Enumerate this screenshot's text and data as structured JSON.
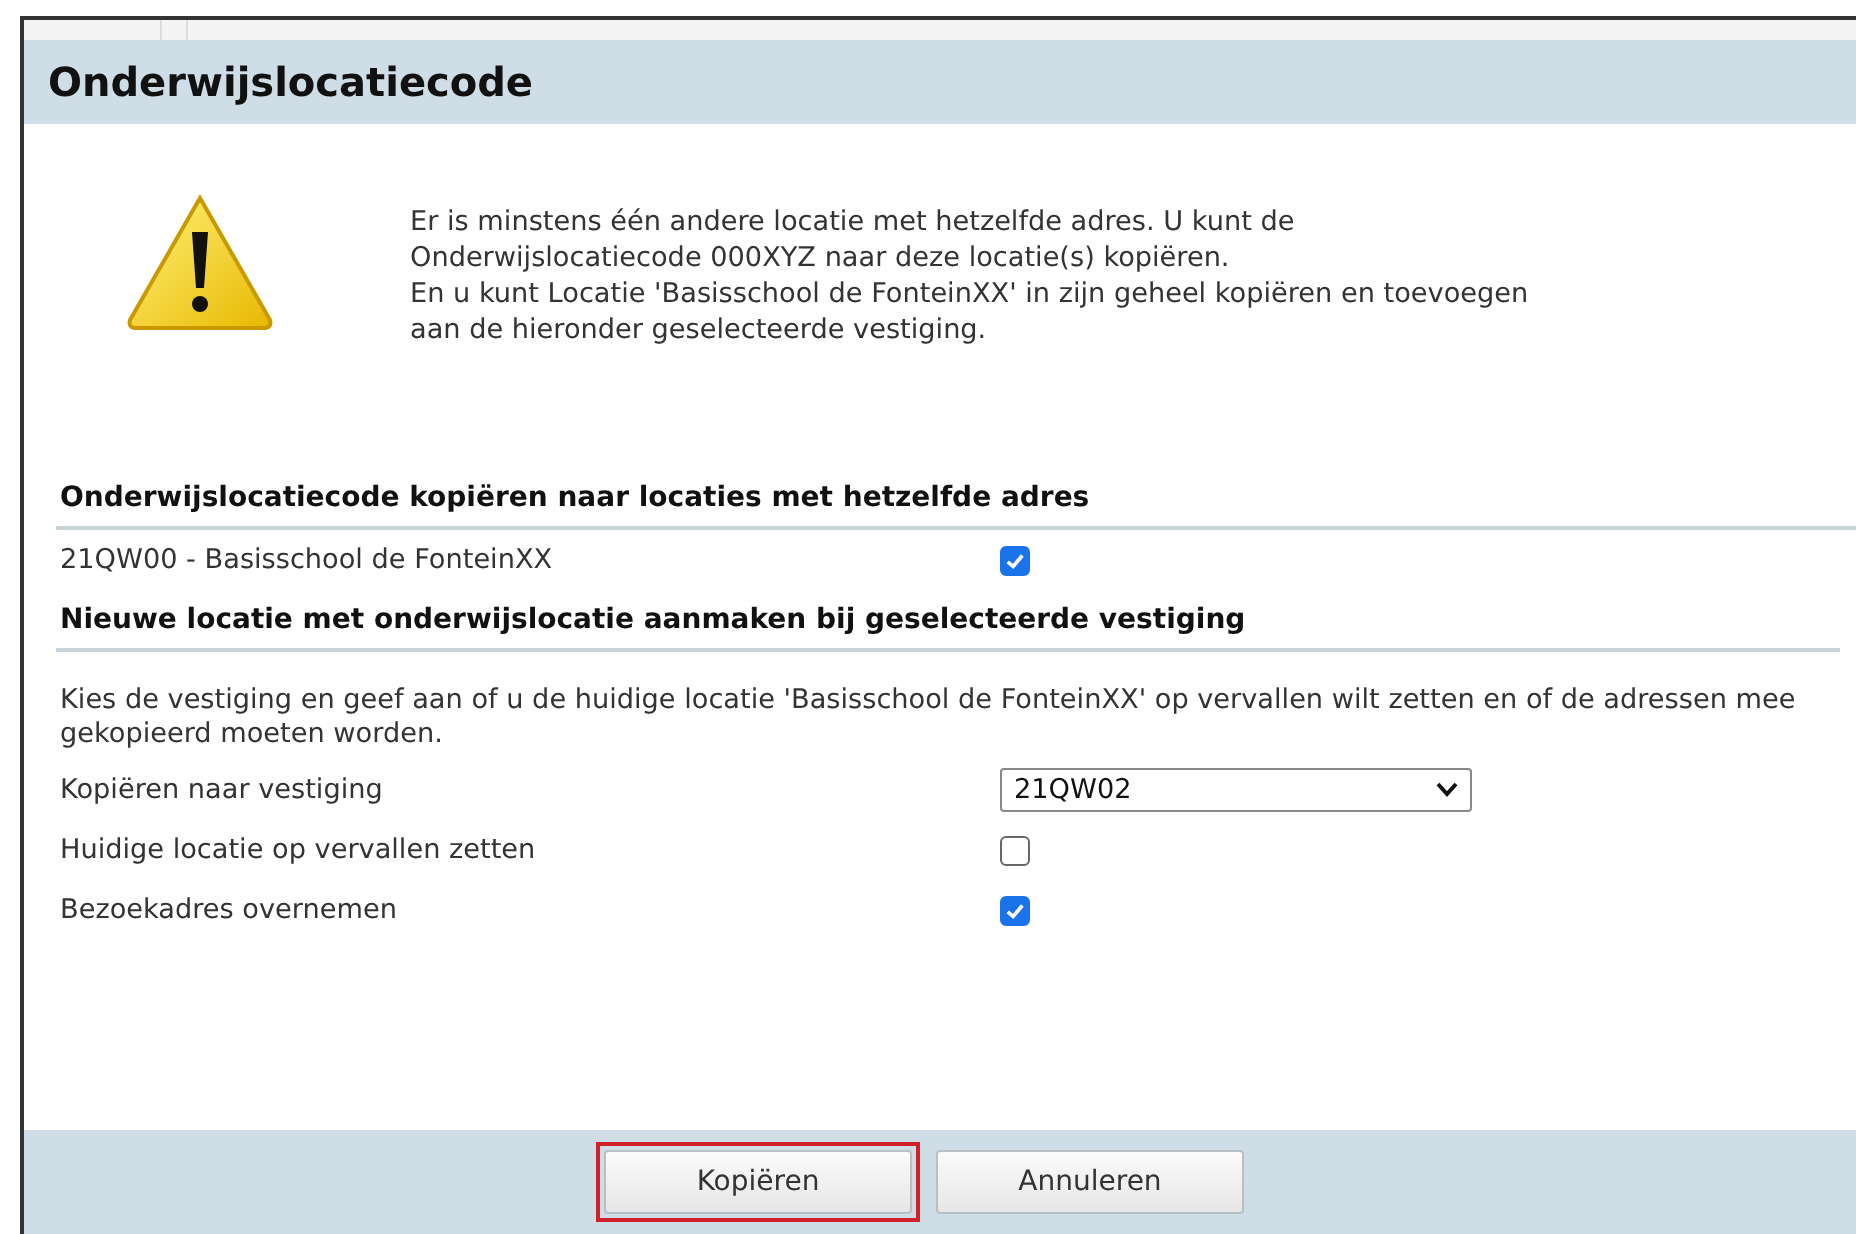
{
  "dialog": {
    "title": "Onderwijslocatiecode",
    "message": [
      "Er is minstens één andere locatie met hetzelfde adres. U kunt de",
      "Onderwijslocatiecode 000XYZ naar deze locatie(s) kopiëren.",
      "En u kunt Locatie 'Basisschool de FonteinXX' in zijn geheel kopiëren en toevoegen",
      "aan de hieronder geselecteerde vestiging."
    ],
    "sections": [
      {
        "heading": "Onderwijslocatiecode kopiëren naar locaties met hetzelfde adres",
        "rows": [
          {
            "kind": "checkbox",
            "label": "21QW00 - Basisschool de FonteinXX",
            "checked": true
          }
        ]
      },
      {
        "heading": "Nieuwe locatie met onderwijslocatie aanmaken bij geselecteerde vestiging",
        "intro": "Kies de vestiging en geef aan of u de huidige locatie 'Basisschool de FonteinXX' op vervallen wilt zetten en of de adressen mee gekopieerd moeten worden.",
        "rows": [
          {
            "kind": "select",
            "label": "Kopiëren naar vestiging",
            "value": "21QW02"
          },
          {
            "kind": "checkbox",
            "label": "Huidige locatie op vervallen zetten",
            "checked": false
          },
          {
            "kind": "checkbox",
            "label": "Bezoekadres overnemen",
            "checked": true
          }
        ]
      }
    ],
    "buttons": [
      {
        "label": "Kopiëren",
        "highlighted": true
      },
      {
        "label": "Annuleren",
        "highlighted": false
      }
    ]
  }
}
